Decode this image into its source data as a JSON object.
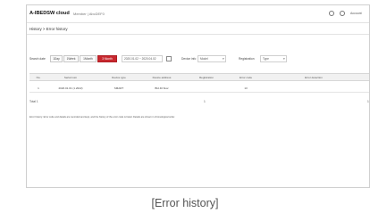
{
  "app": {
    "logo": "A-IBEDSW cloud",
    "subtitle": "Member | AbcDEF0"
  },
  "header_right": {
    "user_label": "Account"
  },
  "breadcrumb": "History > Error history",
  "filter": {
    "search_label": "Search date",
    "period_buttons": [
      "1Day",
      "1Week",
      "1Month",
      "3 Month"
    ],
    "active_period_index": 3,
    "date_range": "2020.01.02 ~ 2020.04.02",
    "device_label": "Device info",
    "device_value": "Model",
    "type_label": "Registration",
    "type_value": "Type"
  },
  "table": {
    "headers": [
      "No.",
      "Serial num",
      "Device type",
      "Device address",
      "Registration",
      "Error code",
      "Error detection"
    ],
    "rows": [
      [
        "1",
        "2020.01.01 (1.2022)",
        "SMART",
        "Bld 40 floor",
        "",
        "13",
        ""
      ]
    ]
  },
  "pagination": {
    "total": "Total 1",
    "page": "1",
    "next": "1"
  },
  "note": "Error history: Error code and details are recorded and kept, and the history of the error code is listed. Details are shown in chronological order.",
  "caption": "[Error history]"
}
